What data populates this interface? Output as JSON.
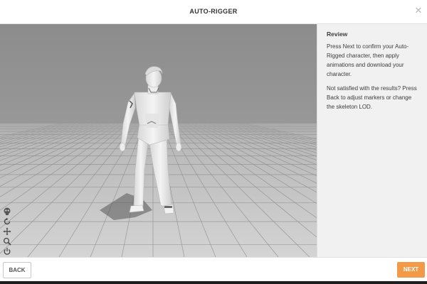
{
  "dialog": {
    "title": "AUTO-RIGGER",
    "close_icon": "close-icon"
  },
  "sidebar": {
    "heading": "Review",
    "paragraph1": "Press Next to confirm your Auto-Rigged character, then apply animations and download your character.",
    "paragraph2": "Not satisfied with the results? Press Back to adjust markers or change the skeleton LOD."
  },
  "viewport_tools": [
    {
      "name": "skeleton-icon",
      "interactable": true
    },
    {
      "name": "rotate-icon",
      "interactable": true
    },
    {
      "name": "pan-icon",
      "interactable": true
    },
    {
      "name": "zoom-icon",
      "interactable": true
    },
    {
      "name": "power-icon",
      "interactable": true
    },
    {
      "name": "camera-icon",
      "interactable": true
    }
  ],
  "footer": {
    "back_label": "BACK",
    "next_label": "NEXT"
  },
  "colors": {
    "accent": "#f29a48",
    "sidebar_bg": "#f1f1f1",
    "viewport_bg": "#9a9a9a"
  }
}
